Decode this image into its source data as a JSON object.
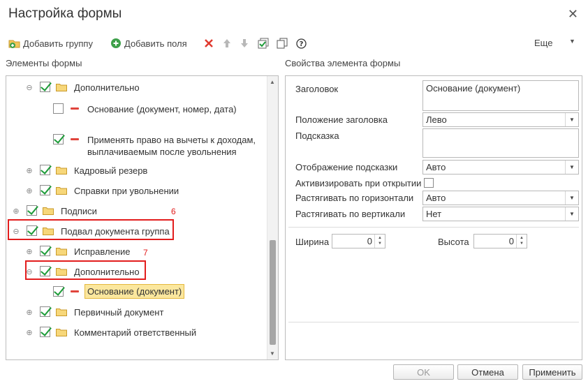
{
  "window": {
    "title": "Настройка формы"
  },
  "toolbar": {
    "add_group_label": "Добавить группу",
    "add_fields_label": "Добавить поля",
    "more_label": "Еще"
  },
  "tree_header": "Элементы формы",
  "props_header": "Свойства элемента формы",
  "tree": {
    "rows": [
      {
        "label": "Дополнительно",
        "checked": true,
        "expanded": true
      },
      {
        "label": "Основание (документ, номер, дата)",
        "checked": false
      },
      {
        "label": "Применять право на вычеты к доходам, выплачиваемым после увольнения",
        "checked": true
      },
      {
        "label": "Кадровый резерв",
        "checked": true,
        "expanded": false
      },
      {
        "label": "Справки при увольнении",
        "checked": true,
        "expanded": false
      },
      {
        "label": "Подписи",
        "checked": true,
        "expanded": false
      },
      {
        "label": "Подвал документа группа",
        "checked": true,
        "expanded": true
      },
      {
        "label": "Исправление",
        "checked": true,
        "expanded": false
      },
      {
        "label": "Дополнительно",
        "checked": true,
        "expanded": true
      },
      {
        "label": "Основание (документ)",
        "checked": true,
        "selected": true
      },
      {
        "label": "Первичный документ",
        "checked": true,
        "expanded": false
      },
      {
        "label": "Комментарий ответственный",
        "checked": true,
        "expanded": false
      }
    ]
  },
  "annotations": {
    "marker_6": "6",
    "marker_7": "7"
  },
  "props": {
    "heading_label": "Заголовок",
    "heading_value": "Основание (документ)",
    "heading_position_label": "Положение заголовка",
    "heading_position_value": "Лево",
    "hint_label": "Подсказка",
    "hint_value": "",
    "hint_display_label": "Отображение подсказки",
    "hint_display_value": "Авто",
    "activate_label": "Активизировать при открытии",
    "activate_checked": false,
    "stretch_h_label": "Растягивать по горизонтали",
    "stretch_h_value": "Авто",
    "stretch_v_label": "Растягивать по вертикали",
    "stretch_v_value": "Нет",
    "width_label": "Ширина",
    "width_value": "0",
    "height_label": "Высота",
    "height_value": "0"
  },
  "buttons": {
    "ok": "OK",
    "cancel": "Отмена",
    "apply": "Применить"
  },
  "colors": {
    "check_green": "#1f9c3a",
    "annotation_red": "#e21d1d",
    "selection_yellow": "#fbe79e"
  }
}
